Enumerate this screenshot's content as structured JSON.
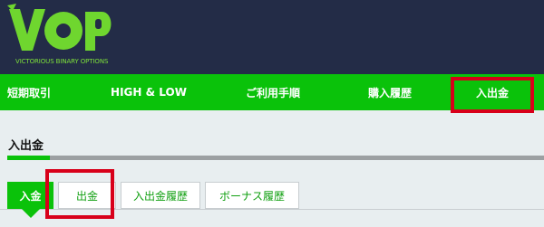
{
  "brand": {
    "logo": "VOP",
    "tagline": "VICTORIOUS BINARY OPTIONS",
    "logo_color": "#6fd62f",
    "header_bg": "#232c47"
  },
  "nav": {
    "items": [
      "短期取引",
      "HIGH & LOW",
      "ご利用手順",
      "購入履歴",
      "入出金"
    ],
    "active_index": 4,
    "bg_color": "#0ac20a"
  },
  "section": {
    "title": "入出金",
    "progress_fraction": 0.08
  },
  "tabs": {
    "items": [
      "入金",
      "出金",
      "入出金履歴",
      "ボーナス履歴"
    ],
    "selected_index": 0
  },
  "highlight_color": "#d8001a",
  "highlighted": [
    "入出金",
    "出金"
  ]
}
